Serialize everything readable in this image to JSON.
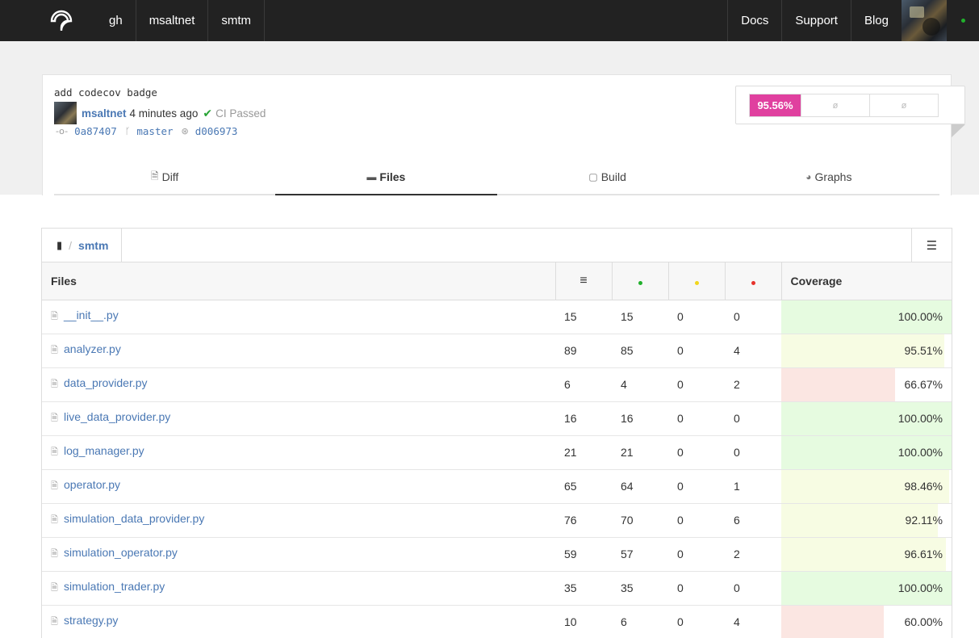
{
  "nav": {
    "left": [
      "gh",
      "msaltnet",
      "smtm"
    ],
    "right": [
      "Docs",
      "Support",
      "Blog"
    ]
  },
  "commit": {
    "message": "add codecov badge",
    "author": "msaltnet",
    "ago": "4 minutes ago",
    "ci_status": "CI Passed",
    "commit_id": "0a87407",
    "branch": "master",
    "parent_id": "d006973"
  },
  "coverage_badge": {
    "main": "95.56%",
    "null1": "ø",
    "null2": "ø",
    "color": "#e0409f"
  },
  "tabs": [
    {
      "label": "Diff",
      "icon": "diff-icon"
    },
    {
      "label": "Files",
      "icon": "folder-icon",
      "active": true
    },
    {
      "label": "Build",
      "icon": "cube-icon"
    },
    {
      "label": "Graphs",
      "icon": "pie-chart-icon"
    }
  ],
  "breadcrumb": {
    "repo": "smtm",
    "sep": "/"
  },
  "table": {
    "headers": {
      "files": "Files",
      "coverage": "Coverage"
    },
    "status_colors": {
      "hit": "#21b02c",
      "partial": "#f1d61c",
      "miss": "#e6322b"
    },
    "rows": [
      {
        "name": "__init__.py",
        "lines": "15",
        "hit": "15",
        "partial": "0",
        "miss": "0",
        "coverage": "100.00%",
        "pct": 100
      },
      {
        "name": "analyzer.py",
        "lines": "89",
        "hit": "85",
        "partial": "0",
        "miss": "4",
        "coverage": "95.51%",
        "pct": 95.51
      },
      {
        "name": "data_provider.py",
        "lines": "6",
        "hit": "4",
        "partial": "0",
        "miss": "2",
        "coverage": "66.67%",
        "pct": 66.67
      },
      {
        "name": "live_data_provider.py",
        "lines": "16",
        "hit": "16",
        "partial": "0",
        "miss": "0",
        "coverage": "100.00%",
        "pct": 100
      },
      {
        "name": "log_manager.py",
        "lines": "21",
        "hit": "21",
        "partial": "0",
        "miss": "0",
        "coverage": "100.00%",
        "pct": 100
      },
      {
        "name": "operator.py",
        "lines": "65",
        "hit": "64",
        "partial": "0",
        "miss": "1",
        "coverage": "98.46%",
        "pct": 98.46
      },
      {
        "name": "simulation_data_provider.py",
        "lines": "76",
        "hit": "70",
        "partial": "0",
        "miss": "6",
        "coverage": "92.11%",
        "pct": 92.11
      },
      {
        "name": "simulation_operator.py",
        "lines": "59",
        "hit": "57",
        "partial": "0",
        "miss": "2",
        "coverage": "96.61%",
        "pct": 96.61
      },
      {
        "name": "simulation_trader.py",
        "lines": "35",
        "hit": "35",
        "partial": "0",
        "miss": "0",
        "coverage": "100.00%",
        "pct": 100
      },
      {
        "name": "strategy.py",
        "lines": "10",
        "hit": "6",
        "partial": "0",
        "miss": "4",
        "coverage": "60.00%",
        "pct": 60
      }
    ]
  }
}
